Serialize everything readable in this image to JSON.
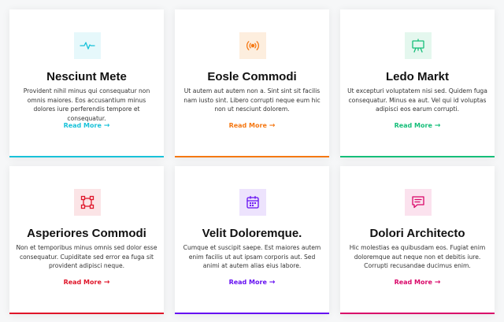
{
  "cards": [
    {
      "title": "Nesciunt Mete",
      "text": "Provident nihil minus qui consequatur non omnis maiores. Eos accusantium minus dolores iure perferendis tempore et consequatur.",
      "link": "Read More",
      "arrow": "→",
      "icon": "heartbeat-icon",
      "accent": "#19c2d9",
      "tint": "#e6f8fb"
    },
    {
      "title": "Eosle Commodi",
      "text": "Ut autem aut autem non a. Sint sint sit facilis nam iusto sint. Libero corrupti neque eum hic non ut nesciunt dolorem.",
      "link": "Read More",
      "arrow": "→",
      "icon": "broadcast-icon",
      "accent": "#f57813",
      "tint": "#fdeede"
    },
    {
      "title": "Ledo Markt",
      "text": "Ut excepturi voluptatem nisi sed. Quidem fuga consequatur. Minus ea aut. Vel qui id voluptas adipisci eos earum corrupti.",
      "link": "Read More",
      "arrow": "→",
      "icon": "easel-icon",
      "accent": "#15be79",
      "tint": "#e4f7ee"
    },
    {
      "title": "Asperiores Commodi",
      "text": "Non et temporibus minus omnis sed dolor esse consequatur. Cupiditate sed error ea fuga sit provident adipisci neque.",
      "link": "Read More",
      "arrow": "→",
      "icon": "bounding-box-icon",
      "accent": "#df1529",
      "tint": "#fbe4e6"
    },
    {
      "title": "Velit Doloremque.",
      "text": "Cumque et suscipit saepe. Est maiores autem enim facilis ut aut ipsam corporis aut. Sed animi at autem alias eius labore.",
      "link": "Read More",
      "arrow": "→",
      "icon": "calendar-icon",
      "accent": "#6610f2",
      "tint": "#ede3fd"
    },
    {
      "title": "Dolori Architecto",
      "text": "Hic molestias ea quibusdam eos. Fugiat enim doloremque aut neque non et debitis iure. Corrupti recusandae ducimus enim.",
      "link": "Read More",
      "arrow": "→",
      "icon": "chat-text-icon",
      "accent": "#d90769",
      "tint": "#fbe2ee"
    }
  ]
}
